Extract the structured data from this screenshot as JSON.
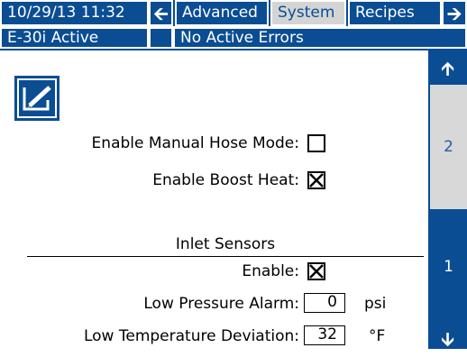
{
  "header": {
    "datetime": "10/29/13 11:32",
    "tabs": [
      {
        "label": "Advanced",
        "selected": false
      },
      {
        "label": "System",
        "selected": true
      },
      {
        "label": "Recipes",
        "selected": false
      }
    ],
    "prev_icon": "left-arrow-icon",
    "next_icon": "right-arrow-icon"
  },
  "status": {
    "mode": "E-30i Active",
    "errors": "No Active Errors"
  },
  "form": {
    "edit_icon": "edit-pencil-icon",
    "manual_hose_label": "Enable Manual Hose Mode:",
    "manual_hose_checked": false,
    "boost_heat_label": "Enable Boost Heat:",
    "boost_heat_checked": true,
    "inlet_heading": "Inlet Sensors",
    "enable_label": "Enable:",
    "enable_checked": true,
    "low_pressure_label": "Low Pressure Alarm:",
    "low_pressure_value": "0",
    "low_pressure_unit": "psi",
    "low_temp_label": "Low Temperature Deviation:",
    "low_temp_value": "32",
    "low_temp_unit": "°F"
  },
  "pager": {
    "page2": "2",
    "page1": "1",
    "up_icon": "up-arrow-icon",
    "down_icon": "down-arrow-icon"
  },
  "colors": {
    "accent": "#0a4d93",
    "selected_tab": "#d4d4d4"
  }
}
